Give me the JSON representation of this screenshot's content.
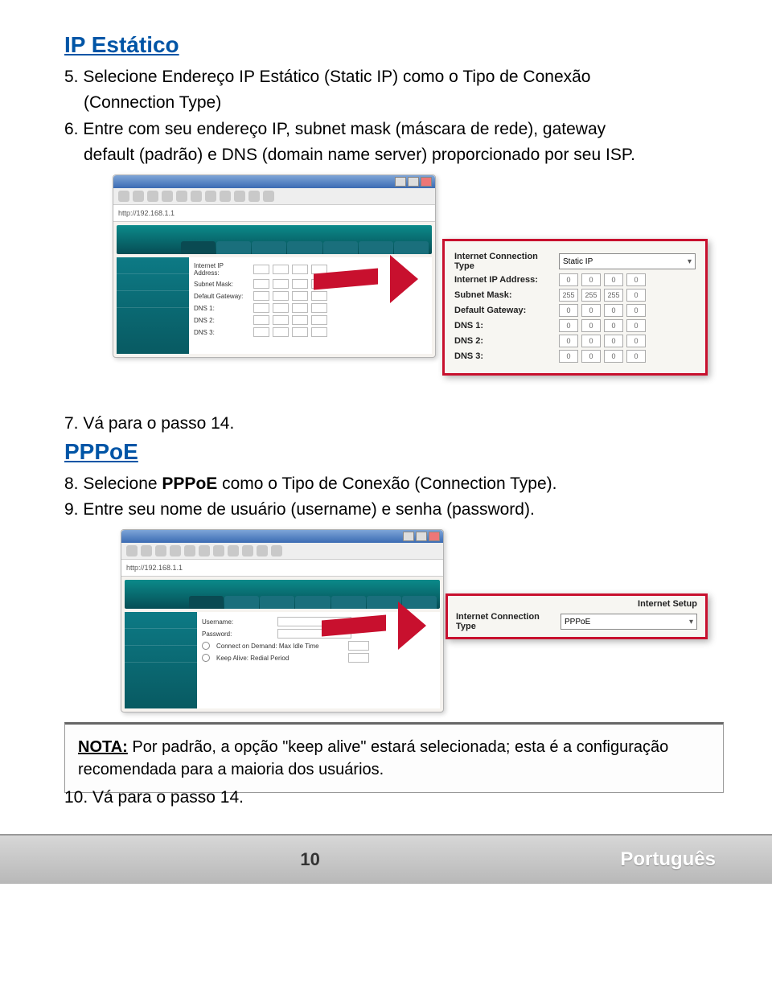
{
  "section1": {
    "title": "IP Estático",
    "step5": "5. Selecione Endereço IP Estático (Static IP) como o Tipo de Conexão",
    "step5b": "(Connection Type)",
    "step6": "6. Entre com seu endereço IP, subnet mask (máscara de rede), gateway",
    "step6b": "default (padrão) e DNS (domain name server) proporcionado por seu ISP.",
    "step7": "7. Vá para o passo 14."
  },
  "section2": {
    "title": "PPPoE",
    "step8a": "8. Selecione ",
    "step8bold": "PPPoE",
    "step8b": " como o Tipo de Conexão (Connection Type).",
    "step9": "9. Entre seu nome de usuário (username) e senha (password)."
  },
  "note": {
    "label": "NOTA:",
    "text": " Por padrão, a opção \"keep alive\" estará selecionada; esta é a configuração recomendada para a maioria dos usuários."
  },
  "step10": "10. Vá para o passo 14.",
  "footer": {
    "page": "10",
    "lang": "Português"
  },
  "popup1": {
    "conn_type_label": "Internet Connection Type",
    "conn_type_value": "Static IP",
    "rows": [
      {
        "label": "Internet IP Address:",
        "vals": [
          "0",
          "0",
          "0",
          "0"
        ]
      },
      {
        "label": "Subnet Mask:",
        "vals": [
          "255",
          "255",
          "255",
          "0"
        ]
      },
      {
        "label": "Default Gateway:",
        "vals": [
          "0",
          "0",
          "0",
          "0"
        ]
      },
      {
        "label": "DNS 1:",
        "vals": [
          "0",
          "0",
          "0",
          "0"
        ]
      },
      {
        "label": "DNS 2:",
        "vals": [
          "0",
          "0",
          "0",
          "0"
        ]
      },
      {
        "label": "DNS 3:",
        "vals": [
          "0",
          "0",
          "0",
          "0"
        ]
      }
    ]
  },
  "popup2": {
    "setup_label": "Internet Setup",
    "conn_type_label": "Internet Connection Type",
    "conn_type_value": "PPPoE"
  },
  "browser": {
    "addr": "http://192.168.1.1",
    "form_labels": [
      "Internet IP Address:",
      "Subnet Mask:",
      "Default Gateway:",
      "DNS 1:",
      "DNS 2:",
      "DNS 3:"
    ]
  },
  "browser2": {
    "form_labels": [
      "Username:",
      "Password:",
      "Connect on Demand: Max Idle Time",
      "Keep Alive: Redial Period"
    ]
  }
}
